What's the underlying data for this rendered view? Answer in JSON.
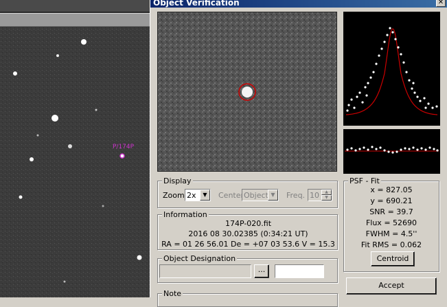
{
  "dialog": {
    "title": "Object Verification",
    "close_glyph": "✕"
  },
  "sky": {
    "object_label": "P/174P"
  },
  "display": {
    "group_label": "Display",
    "zoom_label": "Zoom",
    "zoom_value": "2x",
    "center_label": "Center",
    "center_value": "Object",
    "freq_label": "Freq.",
    "freq_value": "10"
  },
  "information": {
    "group_label": "Information",
    "filename": "174P-020.fit",
    "datetime": "2016 08 30.02385 (0:34:21 UT)",
    "coords": "RA = 01 26 56.01   De = +07 03 53.6   V = 15.3"
  },
  "designation": {
    "group_label": "Object Designation",
    "browse_glyph": "...",
    "value": ""
  },
  "note": {
    "group_label": "Note"
  },
  "psf": {
    "group_label": "PSF - Fit",
    "x": "x = 827.05",
    "y": "y = 690.21",
    "snr": "SNR = 39.7",
    "flux": "Flux = 52690",
    "fwhm": "FWHM = 4.5''",
    "rms": "Fit RMS = 0.062",
    "centroid_label": "Centroid"
  },
  "accept_label": "Accept",
  "colors": {
    "titlebar": "#0a246a",
    "fit_curve": "#cc0000",
    "marker": "#cc33cc"
  }
}
